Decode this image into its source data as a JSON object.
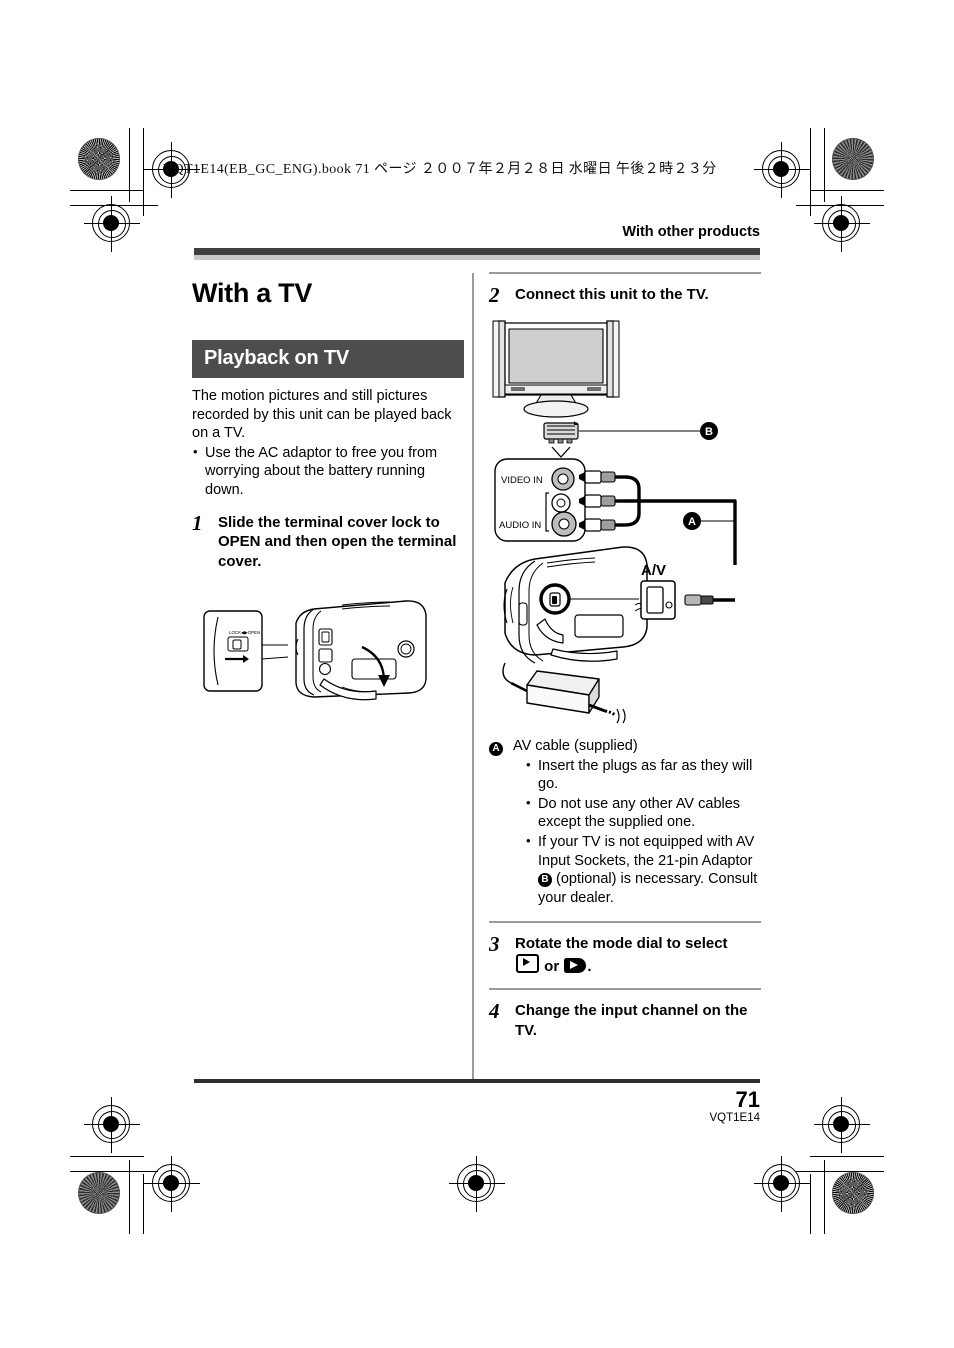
{
  "document": {
    "book_info": "VQT1E14(EB_GC_ENG).book   71 ページ   ２００７年２月２８日   水曜日   午後２時２３分",
    "running_head": "With other products",
    "chapter_title": "With a TV",
    "page_number": "71",
    "page_code": "VQT1E14"
  },
  "left_column": {
    "section_title": "Playback on TV",
    "intro": "The motion pictures and still pictures recorded by this unit can be played back on a TV.",
    "intro_bullets": [
      "Use the AC adaptor to free you from worrying about the battery running down."
    ],
    "step1": {
      "number": "1",
      "text": "Slide the terminal cover lock to OPEN and then open the terminal cover."
    },
    "figure1": {
      "name": "camera-terminal-cover-figure",
      "lock_label": "LOCK",
      "open_label": "OPEN"
    }
  },
  "right_column": {
    "step2": {
      "number": "2",
      "text": "Connect this unit to the TV."
    },
    "figure2": {
      "name": "tv-connection-figure",
      "video_in_label": "VIDEO IN",
      "audio_in_label": "AUDIO IN",
      "av_port_label": "A/V",
      "callout_a": "A",
      "callout_b": "B"
    },
    "notes": {
      "lead": "A",
      "title": "AV cable (supplied)",
      "bullets": [
        "Insert the plugs as far as they will go.",
        "Do not use any other AV cables except the supplied one.",
        "If your TV is not equipped with AV Input Sockets, the 21-pin Adaptor B (optional) is necessary. Consult your dealer."
      ],
      "bullet3_part1": "If your TV is not equipped with AV Input Sockets, the 21-pin Adaptor",
      "bullet3_mark": "B",
      "bullet3_part2": "(optional) is necessary. Consult your dealer."
    },
    "step3": {
      "number": "3",
      "text_part1": "Rotate the mode dial to select",
      "text_or": "or",
      "text_end": ".",
      "icon1": "playback-play-icon",
      "icon2": "movie-playback-icon"
    },
    "step4": {
      "number": "4",
      "text": "Change the input channel on the TV."
    }
  },
  "colors": {
    "section_bar": "#4d4d4d",
    "rule_dark": "#3f3f3f",
    "rule_light": "#c9c9c9",
    "divider": "#9a9a9a"
  }
}
